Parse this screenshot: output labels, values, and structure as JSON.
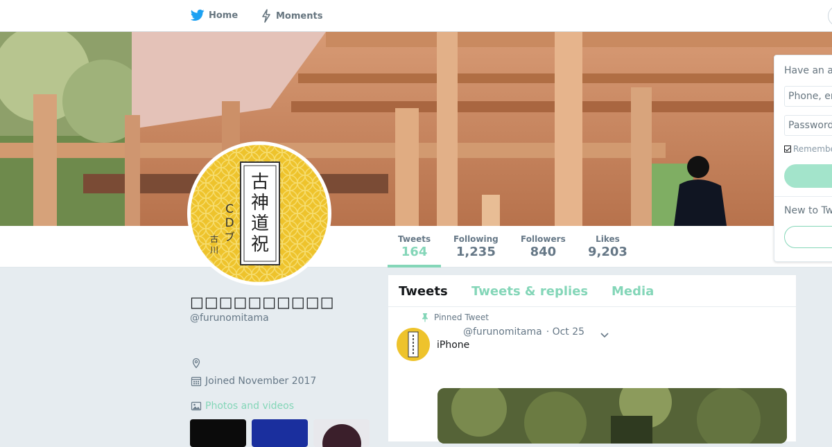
{
  "nav": {
    "home_label": "Home",
    "moments_label": "Moments",
    "icons": [
      "bird-icon",
      "lightning-icon"
    ]
  },
  "colors": {
    "accent": "#84d6b8",
    "text_primary": "#14171a",
    "text_secondary": "#657786",
    "background": "#e6ecf0"
  },
  "stats": [
    {
      "label": "Tweets",
      "value": "164",
      "active": true
    },
    {
      "label": "Following",
      "value": "1,235"
    },
    {
      "label": "Followers",
      "value": "840"
    },
    {
      "label": "Likes",
      "value": "9,203"
    }
  ],
  "profile": {
    "name": "□□□□□□□□□□",
    "handle": "@furunomitama",
    "joined": "Joined November 2017",
    "photos_label": "Photos and videos",
    "avatar_text": "古神道祝詞 CDブック 古川陽明"
  },
  "tabs": [
    {
      "label": "Tweets",
      "active": true
    },
    {
      "label": "Tweets & replies"
    },
    {
      "label": "Media"
    }
  ],
  "tweet": {
    "pinned_label": "Pinned Tweet",
    "handle": "@furunomitama",
    "date": "· Oct 25",
    "text": "iPhone"
  },
  "login": {
    "title": "Have an a",
    "phone_placeholder": "Phone, er",
    "password_placeholder": "Password",
    "remember_label": "Remembe",
    "new_label": "New to Tw"
  }
}
